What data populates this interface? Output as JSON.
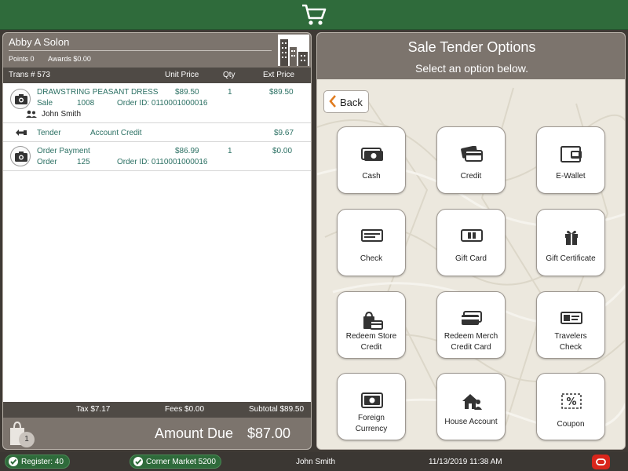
{
  "customer": {
    "name": "Abby A Solon",
    "points": "Points 0",
    "awards": "Awards $0.00"
  },
  "table": {
    "trans": "Trans # 573",
    "unit_price": "Unit Price",
    "qty": "Qty",
    "ext_price": "Ext Price"
  },
  "items": [
    {
      "title": "DRAWSTRING PEASANT DRESS",
      "unit": "$89.50",
      "qty": "1",
      "ext": "$89.50",
      "type": "Sale",
      "code": "1008",
      "order": "Order ID: 0110001000016",
      "person": "John Smith"
    },
    {
      "title": "Tender",
      "detail": "Account Credit",
      "ext": "$9.67"
    },
    {
      "title": "Order Payment",
      "unit": "$86.99",
      "qty": "1",
      "ext": "$0.00",
      "type": "Order",
      "code": "125",
      "order": "Order ID: 0110001000016"
    }
  ],
  "totals": {
    "tax": "Tax $7.17",
    "fees": "Fees $0.00",
    "subtotal": "Subtotal $89.50",
    "due_label": "Amount Due",
    "due_amount": "$87.00",
    "bag_count": "1"
  },
  "tender": {
    "title": "Sale Tender Options",
    "subtitle": "Select an option below.",
    "back": "Back",
    "options": [
      {
        "label1": "Cash",
        "label2": "",
        "icon": "cash-icon"
      },
      {
        "label1": "Credit",
        "label2": "",
        "icon": "credit-card-icon"
      },
      {
        "label1": "E-Wallet",
        "label2": "",
        "icon": "e-wallet-icon"
      },
      {
        "label1": "Check",
        "label2": "",
        "icon": "check-icon"
      },
      {
        "label1": "Gift Card",
        "label2": "",
        "icon": "gift-card-icon"
      },
      {
        "label1": "Gift Certificate",
        "label2": "",
        "icon": "gift-icon"
      },
      {
        "label1": "Redeem Store",
        "label2": "Credit",
        "icon": "store-credit-icon"
      },
      {
        "label1": "Redeem Merch",
        "label2": "Credit Card",
        "icon": "merch-card-icon"
      },
      {
        "label1": "Travelers",
        "label2": "Check",
        "icon": "travelers-check-icon"
      },
      {
        "label1": "Foreign",
        "label2": "Currency",
        "icon": "foreign-currency-icon"
      },
      {
        "label1": "House Account",
        "label2": "",
        "icon": "house-account-icon"
      },
      {
        "label1": "Coupon",
        "label2": "",
        "icon": "coupon-icon"
      }
    ]
  },
  "status": {
    "register": "Register: 40",
    "store": "Corner Market 5200",
    "user": "John Smith",
    "datetime": "11/13/2019 11:38 AM"
  },
  "colors": {
    "header_green": "#2f6b3b",
    "panel_gray": "#7c746d",
    "text_teal": "#2b7063",
    "accent_orange": "#e07b1e",
    "alert_red": "#d9261c"
  }
}
